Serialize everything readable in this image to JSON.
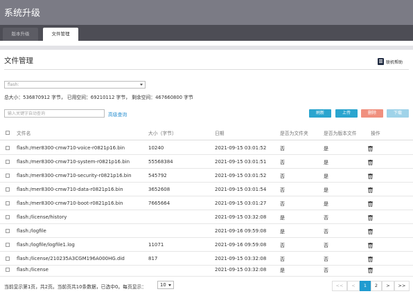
{
  "app": {
    "title": "系统升级"
  },
  "tabs": [
    {
      "label": "版本升级",
      "active": false
    },
    {
      "label": "文件管理",
      "active": true
    }
  ],
  "page": {
    "title": "文件管理",
    "help_label": "联机帮助"
  },
  "storage": {
    "selected": "flash:",
    "summary": "总大小：536870912 字节， 已用空间：69210112 字节， 剩余空间：467660800 字节"
  },
  "search": {
    "placeholder": "输入关键字自动查询",
    "advanced_label": "高级查询"
  },
  "toolbar": {
    "refresh": "刷新",
    "upload": "上传",
    "delete": "删除",
    "download": "下载"
  },
  "table": {
    "headers": {
      "name": "文件名",
      "size": "大小（字节）",
      "date": "日期",
      "is_dir": "是否为文件夹",
      "is_version": "是否为版本文件",
      "actions": "操作"
    },
    "rows": [
      {
        "name": "flash:/mer8300-cmw710-voice-r0821p16.bin",
        "size": "10240",
        "date": "2021-09-15 03:01:52",
        "is_dir": "否",
        "is_version": "是"
      },
      {
        "name": "flash:/mer8300-cmw710-system-r0821p16.bin",
        "size": "55568384",
        "date": "2021-09-15 03:01:51",
        "is_dir": "否",
        "is_version": "是"
      },
      {
        "name": "flash:/mer8300-cmw710-security-r0821p16.bin",
        "size": "545792",
        "date": "2021-09-15 03:01:52",
        "is_dir": "否",
        "is_version": "是"
      },
      {
        "name": "flash:/mer8300-cmw710-data-r0821p16.bin",
        "size": "3652608",
        "date": "2021-09-15 03:01:54",
        "is_dir": "否",
        "is_version": "是"
      },
      {
        "name": "flash:/mer8300-cmw710-boot-r0821p16.bin",
        "size": "7665664",
        "date": "2021-09-15 03:01:27",
        "is_dir": "否",
        "is_version": "是"
      },
      {
        "name": "flash:/license/history",
        "size": "",
        "date": "2021-09-15 03:32:08",
        "is_dir": "是",
        "is_version": "否"
      },
      {
        "name": "flash:/logfile",
        "size": "",
        "date": "2021-09-16 09:59:08",
        "is_dir": "是",
        "is_version": "否"
      },
      {
        "name": "flash:/logfile/logfile1.log",
        "size": "11071",
        "date": "2021-09-16 09:59:08",
        "is_dir": "否",
        "is_version": "否"
      },
      {
        "name": "flash:/license/210235A3CGM196A000HG.did",
        "size": "817",
        "date": "2021-09-15 03:32:08",
        "is_dir": "否",
        "is_version": "否"
      },
      {
        "name": "flash:/license",
        "size": "",
        "date": "2021-09-15 03:32:08",
        "is_dir": "是",
        "is_version": "否"
      }
    ]
  },
  "footer": {
    "summary": "当前显示第1页，共2页。当前页共10条数据，已选中0。每页显示：",
    "page_size": "10",
    "pages": {
      "first": "<<",
      "prev": "<",
      "p1": "1",
      "p2": "2",
      "next": ">",
      "last": ">>"
    },
    "current_page": 1
  },
  "colors": {
    "accent": "#2aa5cf",
    "danger": "#f0907e",
    "active_page": "#1f9bd0",
    "topbar": "#7b7b85",
    "tabbar": "#4d4d55"
  },
  "icons": {
    "help": "help-book-icon",
    "trash": "trash-icon",
    "select_caret": "caret-down-icon"
  }
}
